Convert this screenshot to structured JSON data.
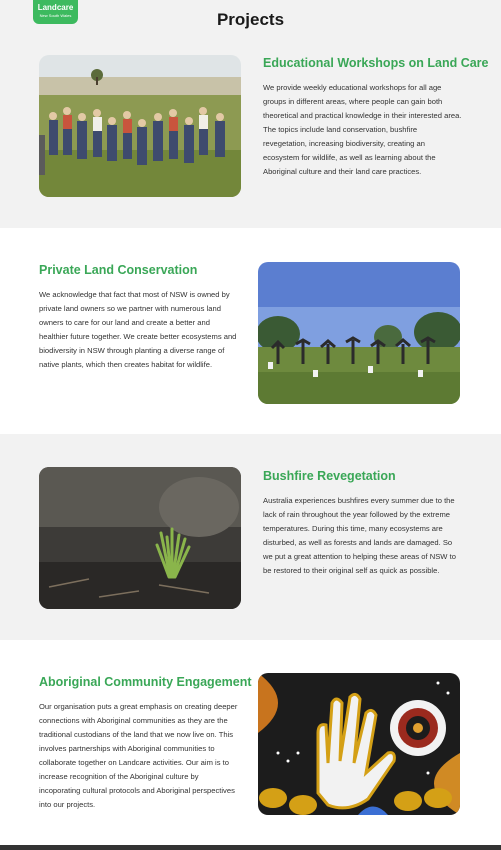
{
  "logo": {
    "name": "Landcare",
    "region": "New South Wales"
  },
  "page": {
    "title": "Projects"
  },
  "projects": [
    {
      "heading": "Educational Workshops on Land Care",
      "text": "We provide weekly educational workshops for all age groups in different areas, where people can gain both theoretical and practical knowledge in their interested area. The topics include land conservation, bushfire revegetation, increasing biodiversity, creating an ecosystem for wildlife, as well as learning about the Aboriginal culture and their land care practices."
    },
    {
      "heading": "Private Land Conservation",
      "text": "We acknowledge that fact that most of NSW is owned by private land owners so we partner with numerous land owners to care for our land and create a better and healthier future together. We create better ecosystems and biodiversity in NSW through planting a diverse range of native plants, which then creates habitat for wildlife."
    },
    {
      "heading": "Bushfire Revegetation",
      "text": "Australia experiences bushfires every summer due to the lack of rain throughout the year followed by the extreme temperatures. During this time, many ecosystems are disturbed, as well as forests and lands are damaged. So we put a great attention to helping these areas of NSW to be restored to their original self as quick as possible."
    },
    {
      "heading": "Aboriginal Community Engagement",
      "text": "Our organisation puts a great emphasis on creating deeper connections with Aboriginal communities as they are the traditional custodians of the land that we now live on. This involves partnerships with Aboriginal communities to collaborate together on Landcare activities. Our aim is to increase recognition of the Aboriginal culture by incoporating cultural protocols and Aboriginal perspectives into our projects."
    }
  ],
  "colors": {
    "accent": "#3aa757",
    "logo": "#3dba5f",
    "band_grey": "#f2f2f2",
    "footer": "#333333"
  }
}
